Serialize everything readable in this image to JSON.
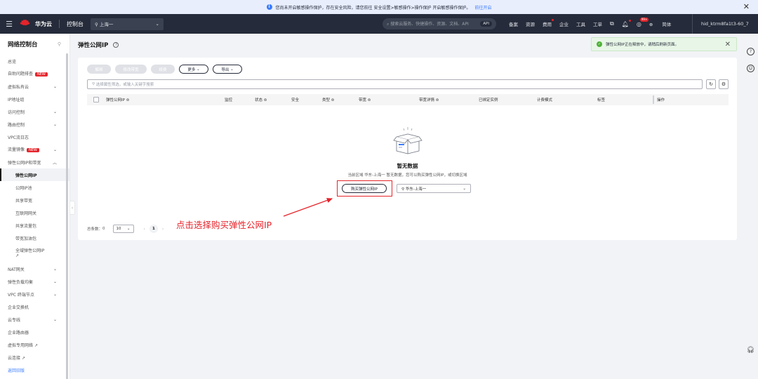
{
  "banner": {
    "text": "您尚未开启敏感操作保护，存在安全风险，请您前往 安全设置>敏感操作>操作保护 开启敏感操作保护。",
    "link": "前往开启",
    "info_icon": "info-icon",
    "close_icon": "close-icon"
  },
  "topbar": {
    "brand": "华为云",
    "console": "控制台",
    "region": "上海一",
    "search_placeholder": "搜索云服务、快捷操作、资源、文档、API",
    "search_api": "API",
    "nav": [
      "备案",
      "资源",
      "费用",
      "企业",
      "工具",
      "工单"
    ],
    "notif_badge": "99+",
    "language": "简体",
    "user": "hid_ktrm8fa1t3-60_7"
  },
  "sidebar": {
    "title": "网络控制台",
    "items": [
      {
        "label": "总览",
        "chevron": false
      },
      {
        "label": "自助问题排查",
        "badge": "NEW",
        "chevron": false
      },
      {
        "label": "虚拟私有云",
        "chevron": true
      },
      {
        "label": "IP地址组",
        "chevron": false
      },
      {
        "label": "访问控制",
        "chevron": true
      },
      {
        "label": "路由控制",
        "chevron": true
      },
      {
        "label": "VPC流日志",
        "chevron": false
      },
      {
        "label": "流量镜像",
        "badge": "NEW",
        "chevron": true
      },
      {
        "label": "弹性公网IP和带宽",
        "chevron": true,
        "expanded": true
      }
    ],
    "sub_items": [
      {
        "label": "弹性公网IP",
        "active": true
      },
      {
        "label": "公网IP池"
      },
      {
        "label": "共享带宽"
      },
      {
        "label": "互联网网关"
      },
      {
        "label": "共享流量包"
      },
      {
        "label": "带宽加油包"
      },
      {
        "label": "全域弹性公网IP"
      }
    ],
    "items2": [
      {
        "label": "NAT网关",
        "chevron": true
      },
      {
        "label": "弹性负载均衡",
        "chevron": true
      },
      {
        "label": "VPC 终端节点",
        "chevron": true
      },
      {
        "label": "企业交换机",
        "chevron": false
      },
      {
        "label": "云专线",
        "chevron": true
      },
      {
        "label": "企业路由器",
        "chevron": false
      },
      {
        "label": "虚拟专用网络",
        "ext": true
      },
      {
        "label": "云连接",
        "ext": true
      }
    ],
    "back": "返回旧版"
  },
  "main": {
    "title": "弹性公网IP",
    "toast": "弹性公网IP正在释放中，请稍后刷新页面。",
    "toolbar": [
      "解绑",
      "修改带宽",
      "续费",
      "更多",
      "导出"
    ],
    "filter_placeholder": "选择属性筛选，或输入关键字搜索",
    "columns": [
      "弹性公网IP",
      "监控",
      "状态",
      "安全",
      "类型",
      "带宽",
      "带宽详情",
      "已绑定实例",
      "计费模式",
      "标签",
      "操作"
    ],
    "empty_title": "暂无数据",
    "empty_desc": "当前区域 华东-上海一 暂无数据，您可以购买弹性公网IP，或切换区域",
    "buy_button": "购买弹性公网IP",
    "region_select": "华东-上海一",
    "pager": {
      "total_label": "总条数：",
      "total": "0",
      "page_size": "10",
      "current_page": "1"
    }
  },
  "annotation": {
    "text": "点击选择购买弹性公网IP",
    "color": "#e5242b"
  }
}
